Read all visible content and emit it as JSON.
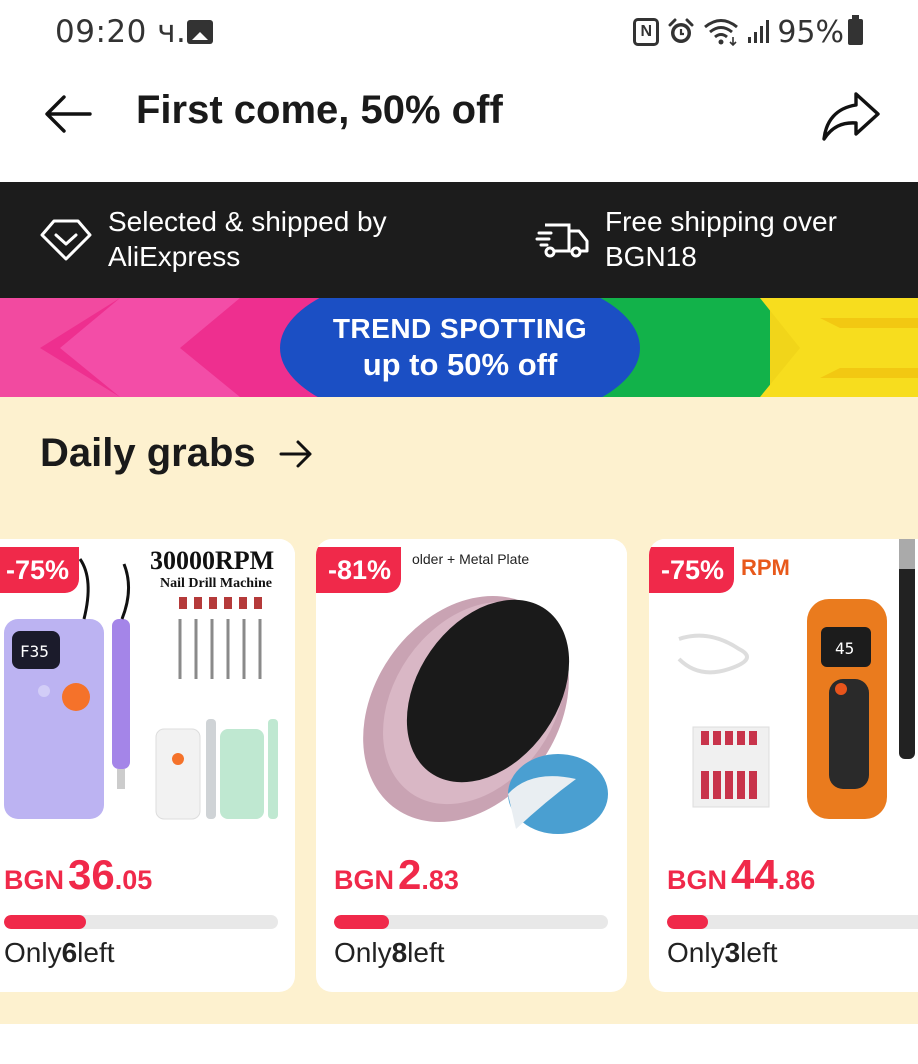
{
  "status_bar": {
    "time": "09:20 ч.",
    "nfc": "N",
    "battery": "95%"
  },
  "header": {
    "title": "First come, 50% off"
  },
  "info_bar": {
    "left_text": "Selected & shipped by AliExpress",
    "right_text": "Free shipping over BGN18"
  },
  "banner": {
    "line1": "TREND SPOTTING",
    "line2": "up to 50% off",
    "colors": [
      "#f02b8a",
      "#1b4fc4",
      "#14b24a",
      "#f9d41a"
    ]
  },
  "daily_grabs": {
    "title": "Daily grabs",
    "products": [
      {
        "discount": "-75%",
        "currency": "BGN",
        "price_int": "36",
        "price_dec": ".05",
        "stock_prefix": "Only",
        "stock_count": "6",
        "stock_suffix": "left",
        "stock_fraction": 0.3,
        "image_text_1": "30000RPM",
        "image_text_2": "Nail Drill Machine",
        "image_screen": "F35"
      },
      {
        "discount": "-81%",
        "currency": "BGN",
        "price_int": "2",
        "price_dec": ".83",
        "stock_prefix": "Only",
        "stock_count": "8",
        "stock_suffix": "left",
        "stock_fraction": 0.2,
        "image_text_1": "older + Metal Plate"
      },
      {
        "discount": "-75%",
        "currency": "BGN",
        "price_int": "44",
        "price_dec": ".86",
        "stock_prefix": "Only",
        "stock_count": "3",
        "stock_suffix": "left",
        "stock_fraction": 0.15,
        "image_text_1": "RPM",
        "image_screen": "45"
      }
    ]
  },
  "colors": {
    "accent": "#f0294a",
    "section_bg": "#fdf1cf",
    "info_bar_bg": "#1c1c1c"
  }
}
